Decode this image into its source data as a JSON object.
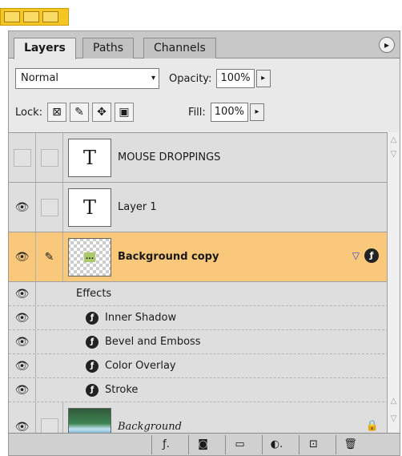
{
  "tabs": [
    {
      "label": "Layers",
      "active": true
    },
    {
      "label": "Paths",
      "active": false
    },
    {
      "label": "Channels",
      "active": false
    }
  ],
  "blend_mode": "Normal",
  "opacity": {
    "label": "Opacity:",
    "value": "100%"
  },
  "lock": {
    "label": "Lock:"
  },
  "fill": {
    "label": "Fill:",
    "value": "100%"
  },
  "layers": [
    {
      "name": "MOUSE DROPPINGS",
      "thumb": "T",
      "visible": false
    },
    {
      "name": "Layer 1",
      "thumb": "T",
      "visible": true
    },
    {
      "name": "Background copy",
      "visible": true,
      "selected": true,
      "linked": true,
      "thumb_text": "..."
    },
    {
      "name": "Background",
      "visible": true,
      "locked": true
    }
  ],
  "effects": {
    "header": "Effects",
    "items": [
      "Inner Shadow",
      "Bevel and Emboss",
      "Color Overlay",
      "Stroke"
    ]
  },
  "colors": {
    "selected_row": "#f9c87a",
    "grip": "#f6c623"
  }
}
